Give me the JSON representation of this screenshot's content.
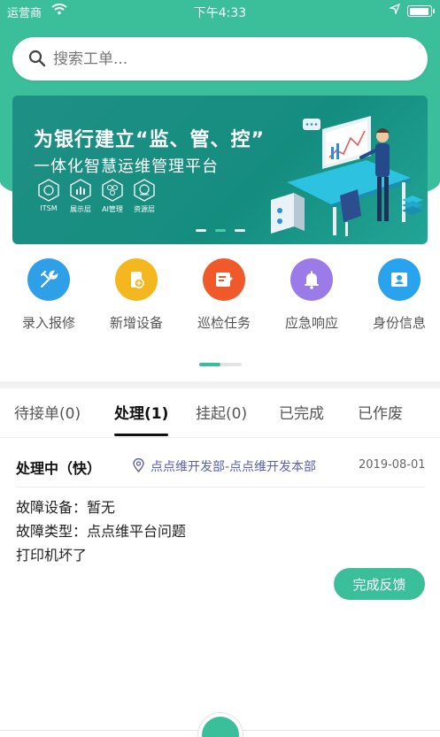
{
  "status_bar": {
    "carrier": "运营商",
    "time": "下午4:33"
  },
  "search": {
    "placeholder": "搜索工单..."
  },
  "banner": {
    "line1": "为银行建立“监、管、控”",
    "line2": "一体化智慧运维管理平台",
    "badges": [
      "ITSM",
      "展示层",
      "AI管理",
      "资源层"
    ],
    "slide_count": 3,
    "active_slide": 2
  },
  "quick_actions": [
    {
      "label": "录入报修",
      "icon": "wrench-icon",
      "color": "#2fa0e8"
    },
    {
      "label": "新增设备",
      "icon": "device-add-icon",
      "color": "#f5b71f"
    },
    {
      "label": "巡检任务",
      "icon": "task-edit-icon",
      "color": "#f05a2b"
    },
    {
      "label": "应急响应",
      "icon": "bell-icon",
      "color": "#9a7be8"
    },
    {
      "label": "身份信息",
      "icon": "id-card-icon",
      "color": "#2aa3ee"
    }
  ],
  "tabs": [
    {
      "label": "待接单(0)"
    },
    {
      "label": "处理(1)"
    },
    {
      "label": "挂起(0)"
    },
    {
      "label": "已完成"
    },
    {
      "label": "已作废"
    }
  ],
  "active_tab": 1,
  "order": {
    "status": "处理中（快）",
    "department": "点点维开发部-点点维开发本部",
    "date": "2019-08-01",
    "device_label": "故障设备：",
    "device_value": "暂无",
    "type_label": "故障类型：",
    "type_value": "点点维平台问题",
    "description": "打印机坏了",
    "action_label": "完成反馈"
  },
  "colors": {
    "brand": "#3bbf9a",
    "dept_link": "#5a5faf"
  }
}
